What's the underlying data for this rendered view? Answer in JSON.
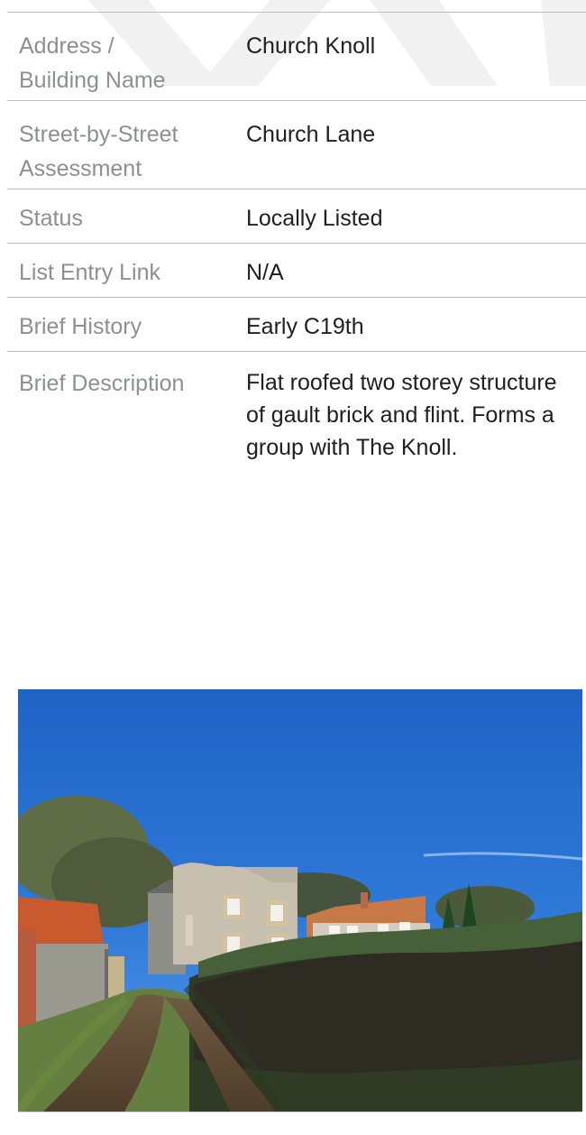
{
  "rows": [
    {
      "label": "Address /\nBuilding Name",
      "value": "Church Knoll"
    },
    {
      "label": "Street-by-Street\nAssessment",
      "value": "Church Lane"
    },
    {
      "label": "Status",
      "value": "Locally Listed"
    },
    {
      "label": "List Entry Link",
      "value": "N/A"
    },
    {
      "label": "Brief History",
      "value": "Early C19th"
    },
    {
      "label": "Brief Description",
      "value": "Flat roofed two storey structure\nof gault brick and flint. Forms a\ngroup with The Knoll."
    }
  ]
}
